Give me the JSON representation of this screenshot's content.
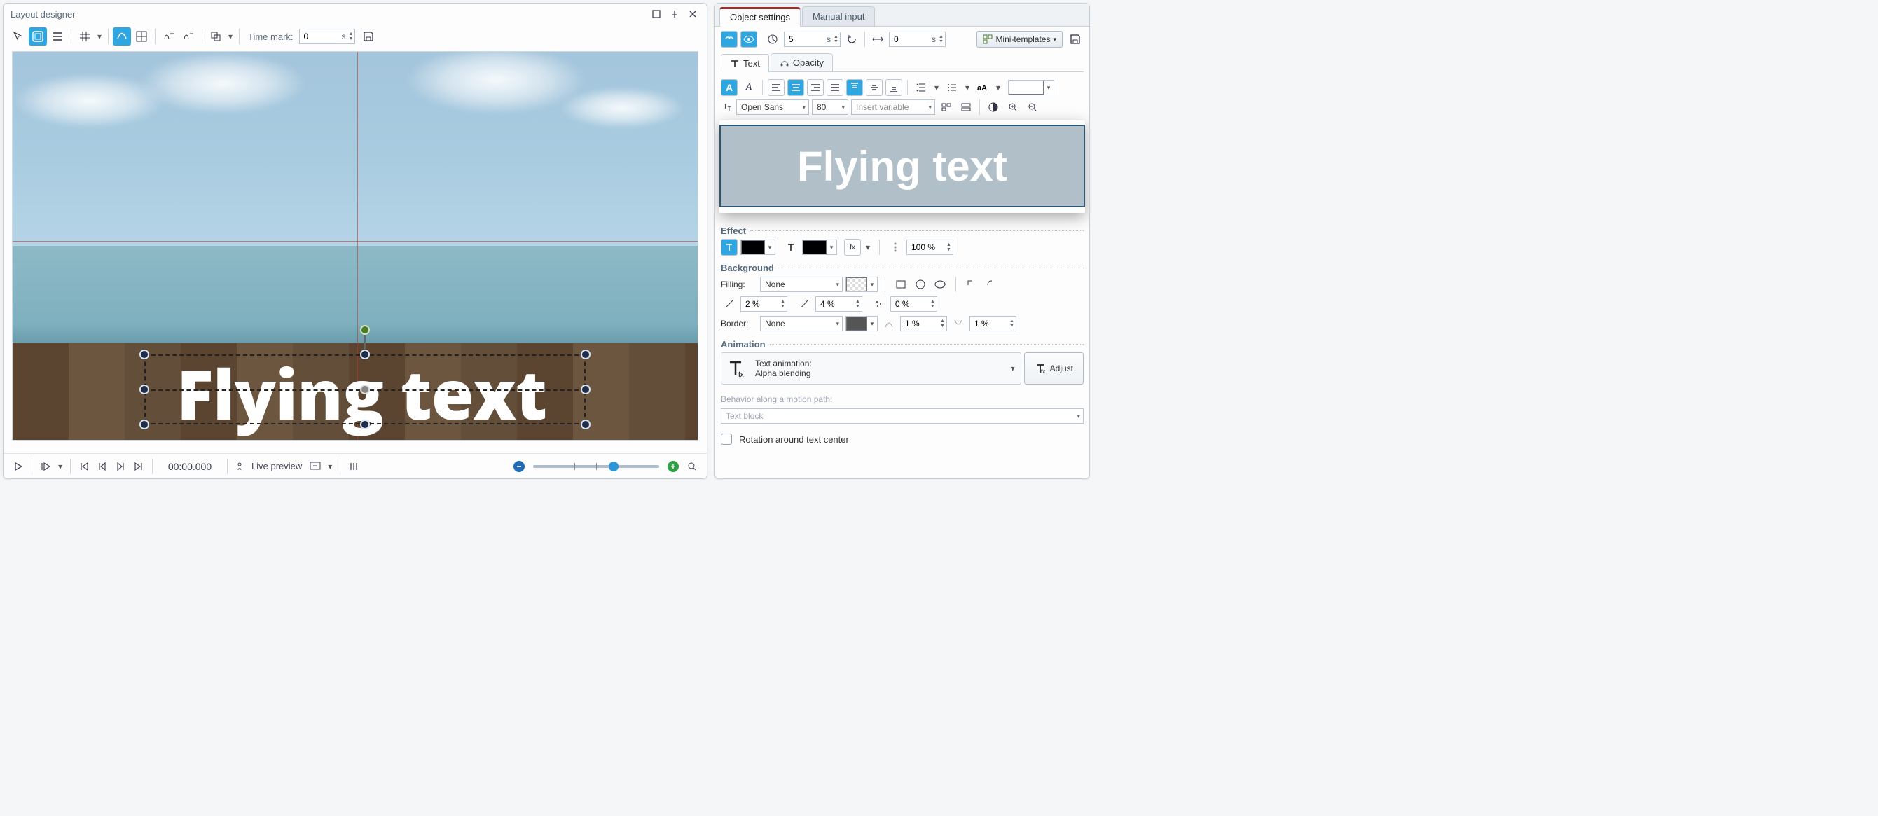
{
  "window": {
    "title": "Layout designer"
  },
  "toolbar": {
    "time_mark_label": "Time mark:",
    "time_mark_value": "0",
    "time_mark_unit": "s"
  },
  "canvas": {
    "text": "Flying text"
  },
  "bottom": {
    "timecode": "00:00.000",
    "live_preview": "Live preview"
  },
  "right": {
    "tabs": {
      "object": "Object settings",
      "manual": "Manual input"
    },
    "timing": {
      "value": "5",
      "unit": "s",
      "offset_value": "0",
      "offset_unit": "s"
    },
    "mini_templates": "Mini-templates",
    "sub_tabs": {
      "text": "Text",
      "opacity": "Opacity"
    },
    "font": {
      "name": "Open Sans",
      "size": "80",
      "insert_var": "Insert variable"
    },
    "preview_text": "Flying text",
    "effect": {
      "label": "Effect",
      "opacity": "100 %"
    },
    "background": {
      "label": "Background",
      "filling_label": "Filling:",
      "filling_value": "None",
      "grad1": "2 %",
      "grad2": "4 %",
      "grad3": "0 %",
      "border_label": "Border:",
      "border_value": "None",
      "border_w1": "1 %",
      "border_w2": "1 %"
    },
    "animation": {
      "label": "Animation",
      "title": "Text animation:",
      "name": "Alpha blending",
      "adjust": "Adjust",
      "behavior_label": "Behavior along a motion path:",
      "behavior_value": "Text block",
      "rotation": "Rotation around text center"
    }
  }
}
